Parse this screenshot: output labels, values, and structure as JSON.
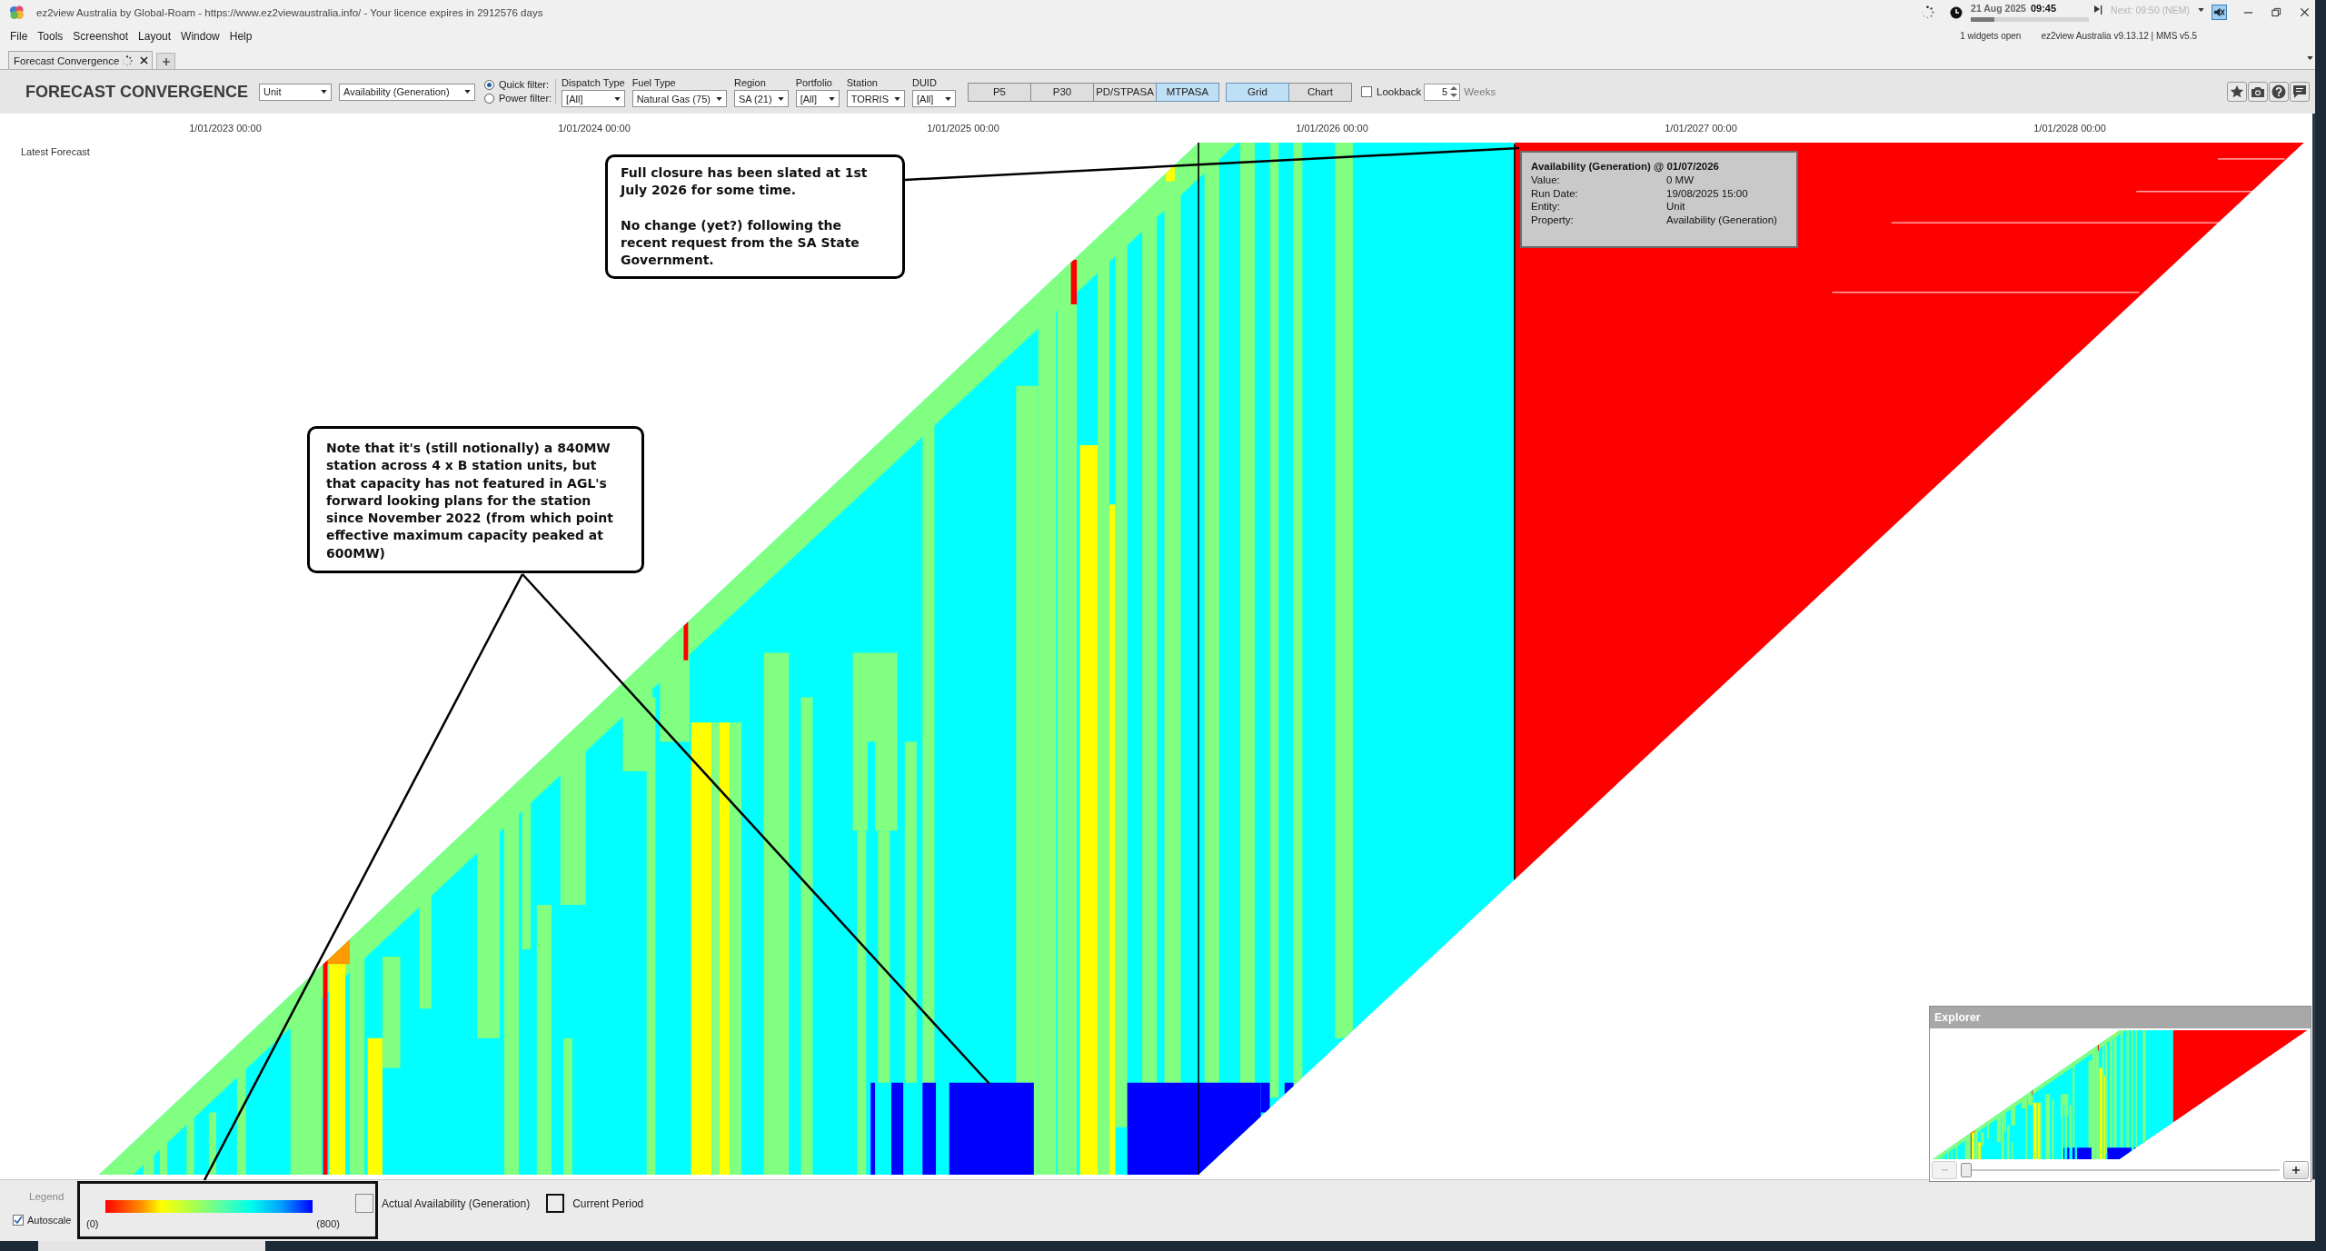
{
  "title_bar": {
    "title": "ez2view Australia by Global-Roam - https://www.ez2viewaustralia.info/ - Your licence expires in 2912576 days",
    "date": "21 Aug 2025",
    "time": "09:45",
    "interval_progress": {
      "level": 0.2
    },
    "next_interval": "Next: 09:50 (NEM)",
    "widgets_open": "1 widgets open",
    "version": "ez2view Australia v9.13.12 | MMS v5.5"
  },
  "menu": [
    "File",
    "Tools",
    "Screenshot",
    "Layout",
    "Window",
    "Help"
  ],
  "tabs": [
    {
      "label": "Forecast Convergence",
      "selected": true
    }
  ],
  "toolbar": {
    "title": "FORECAST CONVERGENCE",
    "entity": "Unit",
    "property": "Availability (Generation)",
    "filter_modes": [
      {
        "label": "Quick filter:",
        "selected": true
      },
      {
        "label": "Power filter:",
        "selected": false
      }
    ],
    "filters": [
      {
        "label": "Dispatch Type",
        "value": "[All]"
      },
      {
        "label": "Fuel Type",
        "value": "Natural Gas (75)"
      },
      {
        "label": "Region",
        "value": "SA (21)"
      },
      {
        "label": "Portfolio",
        "value": "[All]"
      },
      {
        "label": "Station",
        "value": "TORRIS"
      },
      {
        "label": "DUID",
        "value": "[All]"
      }
    ],
    "time_scales": [
      {
        "label": "P5",
        "selected": false
      },
      {
        "label": "P30",
        "selected": false
      },
      {
        "label": "PD/STPASA",
        "selected": false
      },
      {
        "label": "MTPASA",
        "selected": true
      }
    ],
    "views": [
      {
        "label": "Grid",
        "selected": true
      },
      {
        "label": "Chart",
        "selected": false
      }
    ],
    "lookback": {
      "label": "Lookback",
      "checked": false,
      "value": "5",
      "unit": "Weeks"
    }
  },
  "chart": {
    "row_label": "Latest Forecast",
    "x_labels": [
      "1/01/2023 00:00",
      "1/01/2024 00:00",
      "1/01/2025 00:00",
      "1/01/2026 00:00",
      "1/01/2027 00:00",
      "1/01/2028 00:00"
    ]
  },
  "tooltip": {
    "title": "Availability (Generation) @ 01/07/2026",
    "rows": [
      {
        "key": "Value:",
        "value": "0 MW"
      },
      {
        "key": "Run Date:",
        "value": "19/08/2025 15:00"
      },
      {
        "key": "Entity:",
        "value": "Unit"
      },
      {
        "key": "Property:",
        "value": "Availability (Generation)"
      }
    ]
  },
  "callouts": [
    {
      "paragraphs": [
        "Full closure has been slated at 1st July 2026 for some time.",
        "No change (yet?) following the recent request from the SA State Government."
      ]
    },
    {
      "paragraphs": [
        "Note that it's (still notionally) a 840MW station across 4 x B station units, but that capacity has not featured in AGL's forward looking plans for the station since November 2022 (from which point effective maximum capacity peaked at 600MW)"
      ]
    }
  ],
  "legend": {
    "title": "Legend",
    "autoscale": {
      "label": "Autoscale",
      "checked": true
    },
    "scale_min": "(0)",
    "scale_max": "(800)",
    "items": [
      {
        "kind": "actual",
        "label": "Actual Availability (Generation)"
      },
      {
        "kind": "current",
        "label": "Current Period"
      }
    ]
  },
  "explorer": {
    "title": "Explorer",
    "zoom_out": {
      "disabled": true
    },
    "zoom_in": {
      "disabled": false
    },
    "slider": {
      "level": 0
    }
  }
}
